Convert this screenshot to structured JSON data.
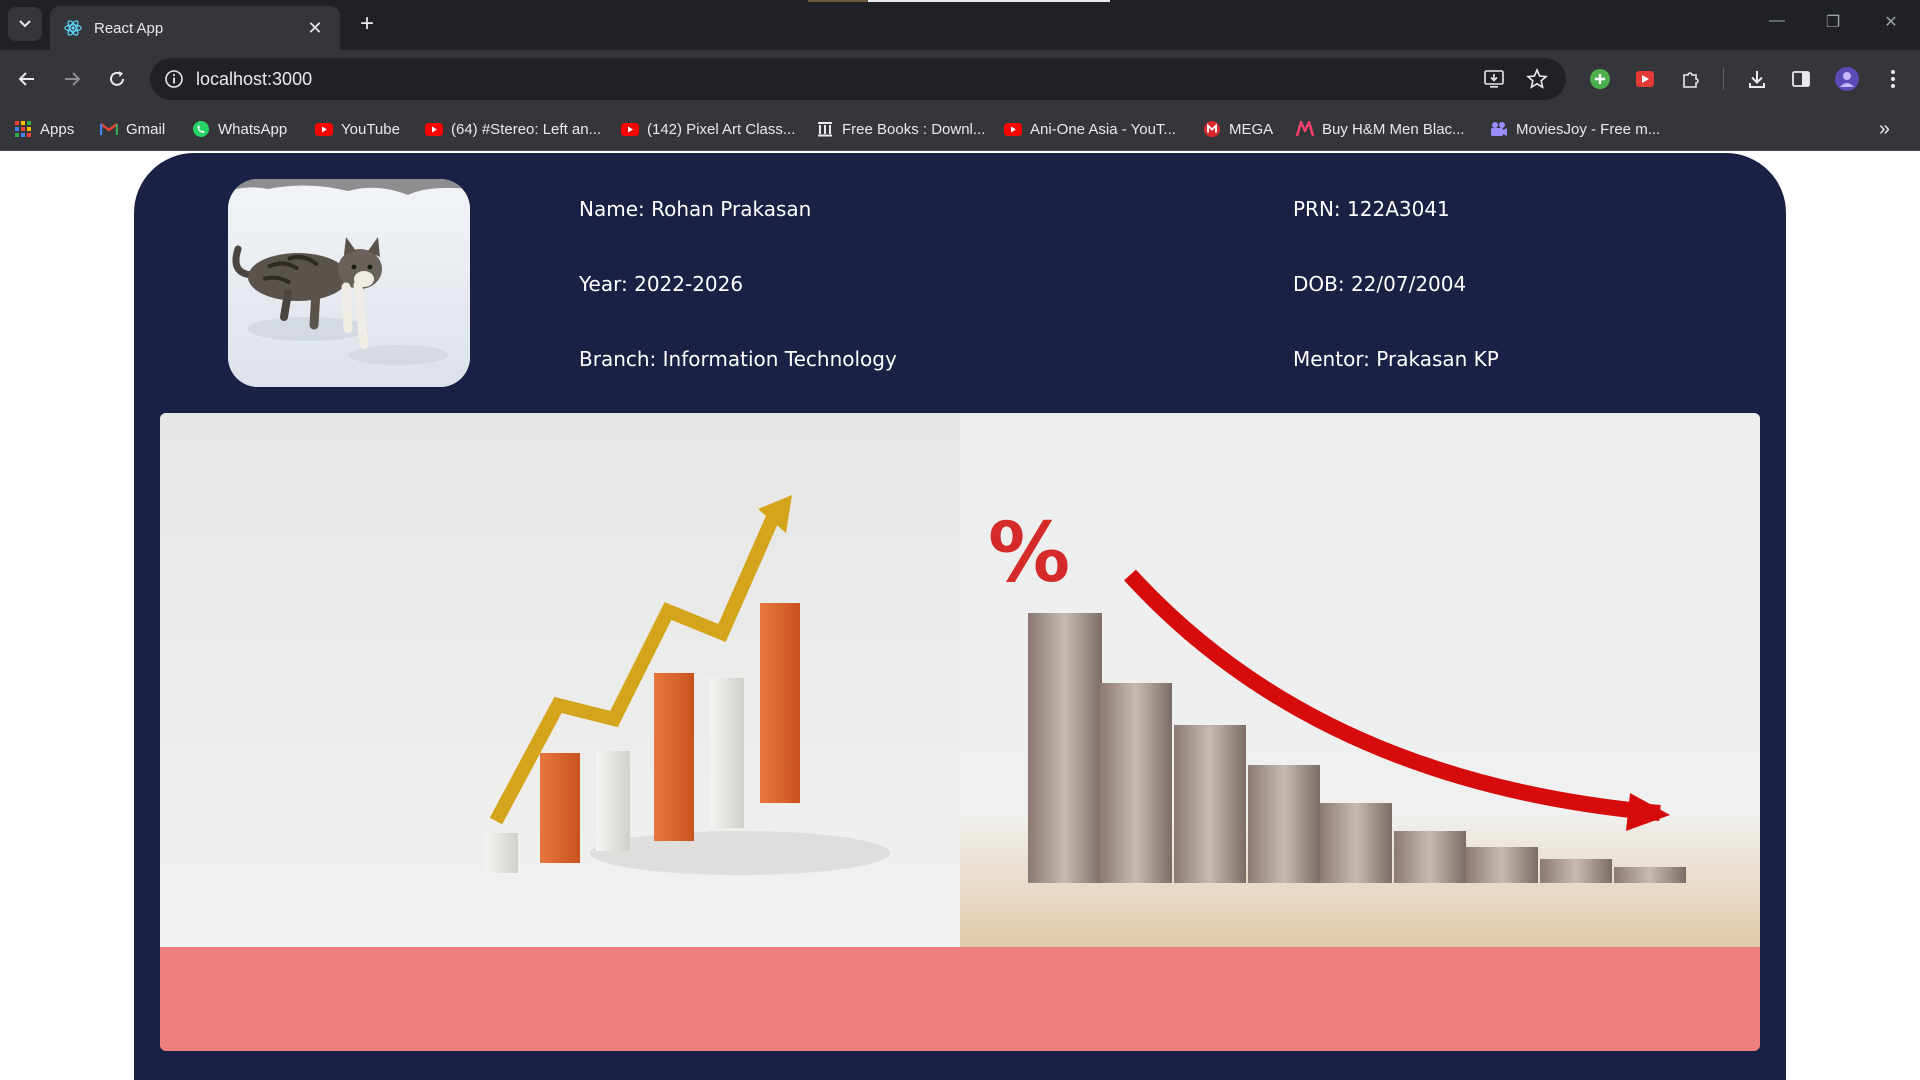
{
  "browser": {
    "tab_title": "React App",
    "url": "localhost:3000",
    "bookmarks": [
      {
        "label": "Apps",
        "icon": "apps-grid-icon"
      },
      {
        "label": "Gmail",
        "icon": "gmail-icon"
      },
      {
        "label": "WhatsApp",
        "icon": "whatsapp-icon"
      },
      {
        "label": "YouTube",
        "icon": "youtube-icon"
      },
      {
        "label": "(64) #Stereo: Left an...",
        "icon": "youtube-icon"
      },
      {
        "label": "(142) Pixel Art Class...",
        "icon": "youtube-icon"
      },
      {
        "label": "Free Books : Downl...",
        "icon": "library-icon"
      },
      {
        "label": "Ani-One Asia - YouT...",
        "icon": "youtube-icon"
      },
      {
        "label": "MEGA",
        "icon": "mega-icon"
      },
      {
        "label": "Buy H&M Men Blac...",
        "icon": "myntra-icon"
      },
      {
        "label": "MoviesJoy - Free m...",
        "icon": "moviesjoy-icon"
      }
    ]
  },
  "profile": {
    "name": "Name: Rohan Prakasan",
    "year": "Year: 2022-2026",
    "branch": "Branch: Information Technology",
    "prn": "PRN: 122A3041",
    "dob": "DOB: 22/07/2004",
    "mentor": "Mentor: Prakasan KP"
  },
  "banner": {
    "percent_symbol": "%"
  },
  "colors": {
    "card_bg": "#1b2045",
    "pink_bar": "#ef7f7d"
  }
}
